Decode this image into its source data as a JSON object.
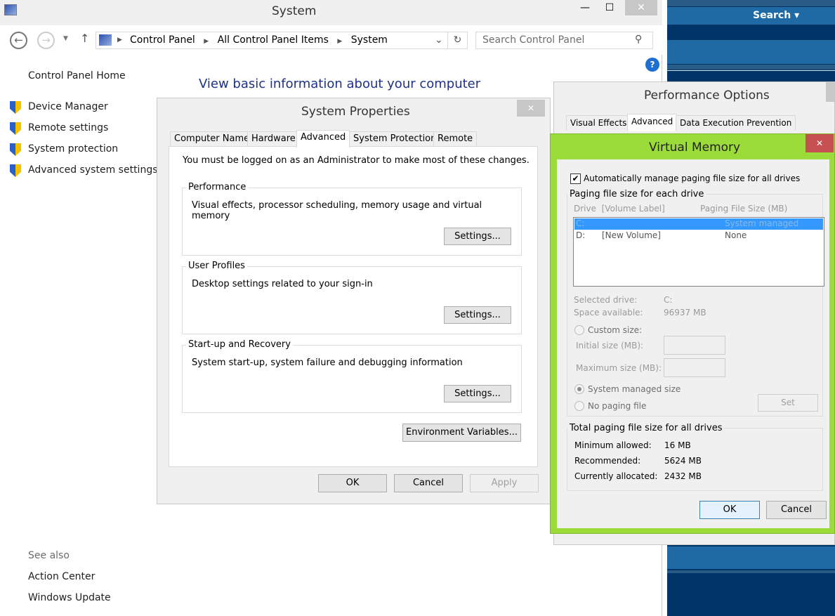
{
  "window": {
    "title": "System",
    "minimize": "—",
    "maximize": "☐",
    "close": "✕"
  },
  "nav": {
    "breadcrumb": [
      "Control Panel",
      "All Control Panel Items",
      "System"
    ],
    "search_placeholder": "Search Control Panel"
  },
  "sidebar": {
    "home": "Control Panel Home",
    "items": [
      {
        "label": "Device Manager",
        "icon": "shield-icon"
      },
      {
        "label": "Remote settings",
        "icon": "shield-icon"
      },
      {
        "label": "System protection",
        "icon": "shield-icon"
      },
      {
        "label": "Advanced system settings",
        "icon": "shield-icon"
      }
    ],
    "see_also": "See also",
    "see_also_links": [
      "Action Center",
      "Windows Update"
    ]
  },
  "main": {
    "heading": "View basic information about your computer"
  },
  "background": {
    "search_label": "Search ▾"
  },
  "system_properties": {
    "title": "System Properties",
    "tabs": [
      "Computer Name",
      "Hardware",
      "Advanced",
      "System Protection",
      "Remote"
    ],
    "active_tab": "Advanced",
    "admin_note": "You must be logged on as an Administrator to make most of these changes.",
    "groups": [
      {
        "title": "Performance",
        "desc": "Visual effects, processor scheduling, memory usage and virtual memory",
        "button": "Settings..."
      },
      {
        "title": "User Profiles",
        "desc": "Desktop settings related to your sign-in",
        "button": "Settings..."
      },
      {
        "title": "Start-up and Recovery",
        "desc": "System start-up, system failure and debugging information",
        "button": "Settings..."
      }
    ],
    "env_button": "Environment Variables...",
    "ok": "OK",
    "cancel": "Cancel",
    "apply": "Apply"
  },
  "performance_options": {
    "title": "Performance Options",
    "tabs": [
      "Visual Effects",
      "Advanced",
      "Data Execution Prevention"
    ],
    "active_tab": "Advanced"
  },
  "virtual_memory": {
    "title": "Virtual Memory",
    "accent": "#9bdb3a",
    "auto_manage_label": "Automatically manage paging file size for all drives",
    "auto_manage_checked": true,
    "group_title": "Paging file size for each drive",
    "col_drive": "Drive  [Volume Label]",
    "col_size": "Paging File Size (MB)",
    "drives": [
      {
        "drive": "C:",
        "label": "",
        "size": "System managed",
        "selected": true
      },
      {
        "drive": "D:",
        "label": "[New Volume]",
        "size": "None",
        "selected": false
      }
    ],
    "selected_drive_label": "Selected drive:",
    "selected_drive": "C:",
    "space_label": "Space available:",
    "space": "96937 MB",
    "custom_size": "Custom size:",
    "initial_size": "Initial size (MB):",
    "maximum_size": "Maximum size (MB):",
    "system_managed": "System managed size",
    "no_paging": "No paging file",
    "selected_option": "System managed size",
    "set": "Set",
    "total_title": "Total paging file size for all drives",
    "min_label": "Minimum allowed:",
    "min": "16 MB",
    "rec_label": "Recommended:",
    "rec": "5624 MB",
    "cur_label": "Currently allocated:",
    "cur": "2432 MB",
    "ok": "OK",
    "cancel": "Cancel"
  }
}
